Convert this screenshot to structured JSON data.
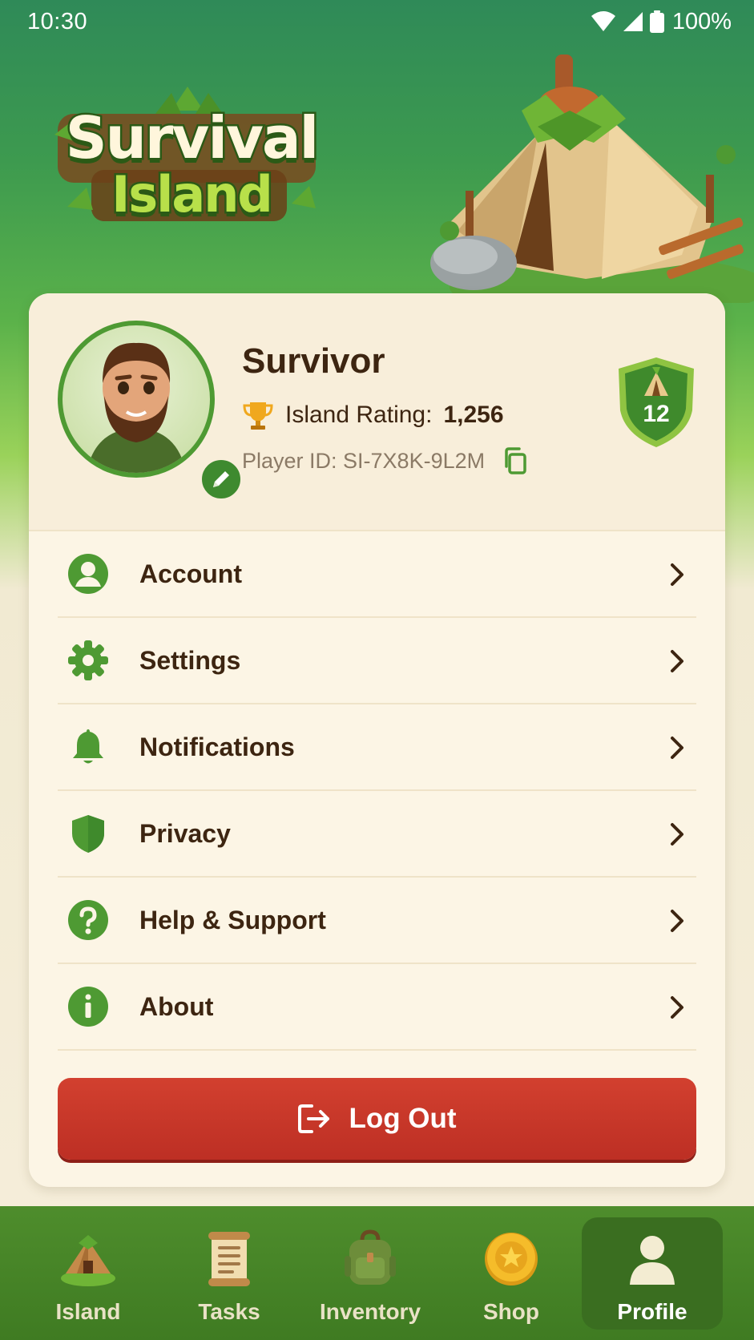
{
  "status_bar": {
    "time": "10:30",
    "battery": "100%"
  },
  "logo": {
    "line1": "Survival",
    "line2": "Island"
  },
  "profile": {
    "name": "Survivor",
    "rating_label": "Island Rating:",
    "rating_value": "1,256",
    "player_id": "Player ID: SI-7X8K-9L2M",
    "level": "12"
  },
  "menu": [
    {
      "label": "Account",
      "icon": "account-icon"
    },
    {
      "label": "Settings",
      "icon": "gear-icon"
    },
    {
      "label": "Notifications",
      "icon": "bell-icon"
    },
    {
      "label": "Privacy",
      "icon": "shield-icon"
    },
    {
      "label": "Help & Support",
      "icon": "help-icon"
    },
    {
      "label": "About",
      "icon": "info-icon"
    }
  ],
  "logout_label": "Log Out",
  "nav": [
    {
      "label": "Island",
      "icon": "island-hut-icon",
      "active": false
    },
    {
      "label": "Tasks",
      "icon": "scroll-icon",
      "active": false
    },
    {
      "label": "Inventory",
      "icon": "backpack-icon",
      "active": false
    },
    {
      "label": "Shop",
      "icon": "coin-icon",
      "active": false
    },
    {
      "label": "Profile",
      "icon": "person-icon",
      "active": true
    }
  ],
  "colors": {
    "accent_green": "#4e9a33",
    "logout_red": "#c63a2b",
    "card_bg": "#fcf5e5",
    "nav_bg": "#46852a"
  }
}
